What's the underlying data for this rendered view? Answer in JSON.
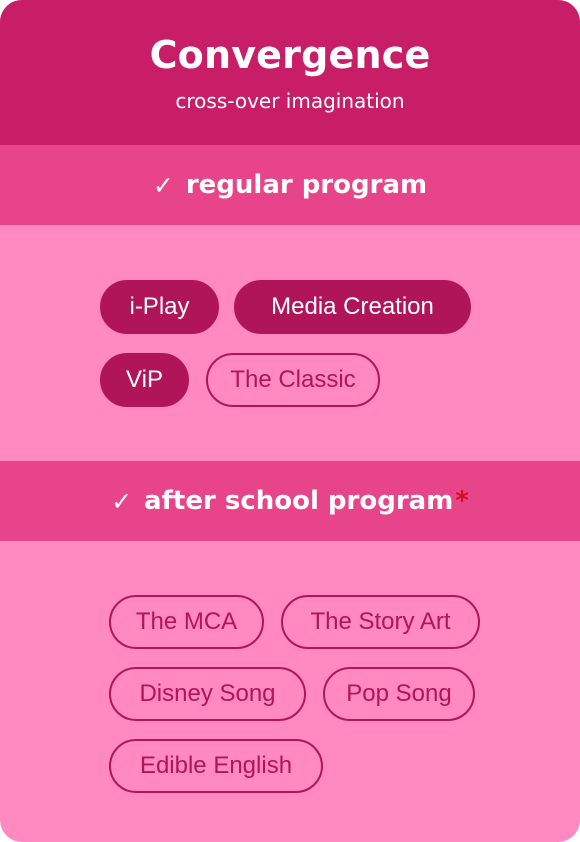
{
  "header": {
    "title": "Convergence",
    "subtitle": "cross-over imagination"
  },
  "sections": [
    {
      "check_icon": "check-icon",
      "label": "regular program",
      "chips": [
        {
          "label": "i-Play",
          "selected": true
        },
        {
          "label": "Media Creation",
          "selected": true
        },
        {
          "label": "ViP",
          "selected": true
        },
        {
          "label": "The Classic",
          "selected": false
        }
      ]
    },
    {
      "check_icon": "check-icon",
      "label": "after school program",
      "required_marker": "*",
      "chips": [
        {
          "label": "The MCA",
          "selected": false
        },
        {
          "label": "The Story Art",
          "selected": false
        },
        {
          "label": "Disney Song",
          "selected": false
        },
        {
          "label": "Pop Song",
          "selected": false
        },
        {
          "label": "Edible English",
          "selected": false
        }
      ]
    }
  ],
  "colors": {
    "header_bg": "#c81e68",
    "band_bg": "#e8448a",
    "body_bg": "#ff89c0",
    "chip_accent": "#b0155a",
    "required_marker": "#d0102a"
  }
}
